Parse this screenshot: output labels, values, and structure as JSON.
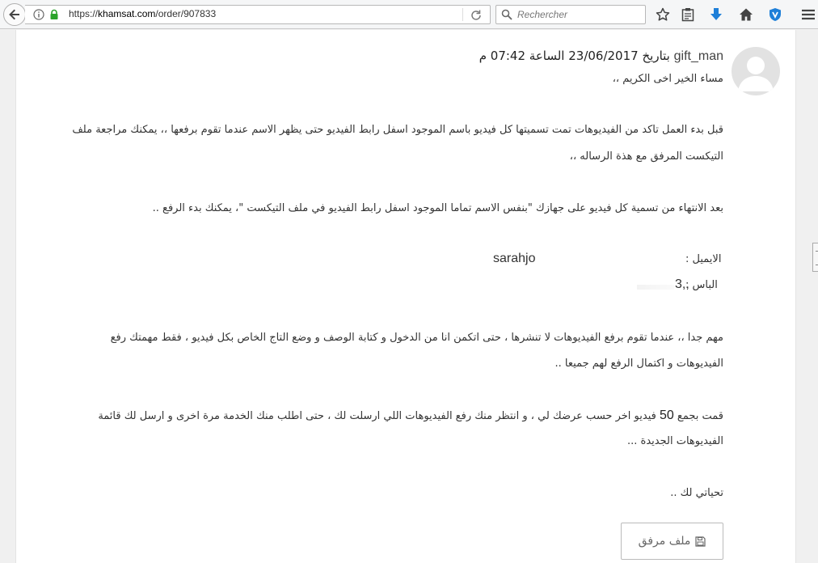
{
  "browser": {
    "url_prefix": "https://",
    "url_domain": "khamsat.com",
    "url_path": "/order/907833",
    "search_placeholder": "Rechercher"
  },
  "message": {
    "username": "gift_man",
    "timestamp": "بتاريخ 23/06/2017 الساعة 07:42 م",
    "greeting": "مساء الخير اخى الكريم ،،",
    "p1_line1": "قبل بدء العمل تاكد من الفيديوهات تمت تسميتها كل فيديو باسم الموجود اسفل رابط الفيديو حتى يظهر الاسم عندما تقوم برفعها ،، يمكنك مراجعة ملف",
    "p1_line2": "التيكست المرفق مع هذة الرساله ،،",
    "p2": "بعد الانتهاء من تسمية كل فيديو على جهازك \"بنفس الاسم تماما الموجود اسفل رابط الفيديو في ملف التيكست \"، يمكنك بدء الرفع ..",
    "email_label": "الايميل :",
    "email_value": "sarahjo",
    "password_label": "الباس :",
    "password_value": "3,,",
    "p3_line1": "مهم جدا ،، عندما تقوم برفع الفيديوهات لا تنشرها ، حتى اتكمن انا من الدخول و كتابة الوصف و وضع التاج الخاص بكل فيديو ، فقط مهمتك رفع",
    "p3_line2": "الفيديوهات و اكتمال الرفع لهم جميعا ..",
    "p4_line1_before": "قمت بجمع",
    "p4_number": "50",
    "p4_line1_after": "فيديو اخر حسب عرضك لي ، و انتظر منك رفع الفيديوهات اللي ارسلت لك ، حتى اطلب منك الخدمة مرة اخرى و ارسل لك قائمة",
    "p4_line2": "الفيديوهات الجديدة ...",
    "signoff": "تحياتي لك ..",
    "attachment_label": "ملف مرفق"
  }
}
